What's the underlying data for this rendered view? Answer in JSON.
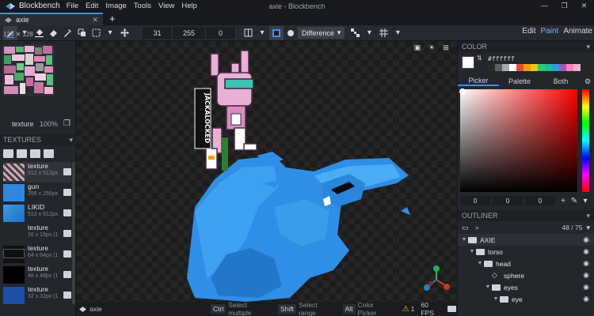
{
  "titlebar": {
    "app_name": "Blockbench",
    "window_title": "axie - Blockbench",
    "menu": [
      "File",
      "Edit",
      "Image",
      "Tools",
      "View",
      "Help"
    ],
    "controls": [
      "—",
      "❐",
      "✕"
    ]
  },
  "tabbar": {
    "tab_label": "axie",
    "close": "✕",
    "new_tab": "+"
  },
  "toolbar": {
    "field_1": "31",
    "field_2": "255",
    "field_3": "0",
    "blend_mode": "Difference",
    "modes": [
      "Edit",
      "Paint",
      "Animate"
    ],
    "active_mode": "Paint"
  },
  "left": {
    "uv_size": "128 ✕ 128",
    "texture_label": "texture",
    "zoom": "100%",
    "textures_header": "TEXTURES",
    "textures": [
      {
        "name": "texture",
        "size": "512 x 512px",
        "thumb": "#c9a5b6"
      },
      {
        "name": "gun",
        "size": "256 x 256px",
        "thumb": "#2e86de"
      },
      {
        "name": "LIKID",
        "size": "512 x 512px",
        "thumb": "#3a9be8"
      },
      {
        "name": "texture",
        "size": "16 x 16px (1",
        "thumb": "#24272c"
      },
      {
        "name": "texture",
        "size": "64 x 64px (1",
        "thumb": "#101010"
      },
      {
        "name": "texture",
        "size": "48 x 48px (1",
        "thumb": "#000000"
      },
      {
        "name": "texture",
        "size": "32 x 32px (1",
        "thumb": "#1d4fa8"
      }
    ]
  },
  "viewport": {
    "tools": [
      "▣",
      "☀",
      "⊞"
    ]
  },
  "status": {
    "model_name": "axie",
    "hints": [
      {
        "key": "Ctrl",
        "text": "Select multiple"
      },
      {
        "key": "Shift",
        "text": "Select range"
      },
      {
        "key": "Alt",
        "text": "Color Picker"
      }
    ],
    "warn_count": "1",
    "fps": "60 FPS"
  },
  "color": {
    "header": "COLOR",
    "hex": "#ffffff",
    "tabs": [
      "Picker",
      "Palette",
      "Both"
    ],
    "active_tab": "Picker",
    "palette": [
      "#2b2b2b",
      "#5e5e5e",
      "#a8a8a8",
      "#ffffff",
      "#e74c3c",
      "#f39c12",
      "#f1c40f",
      "#2ecc71",
      "#1abc9c",
      "#3498db",
      "#9b59b6",
      "#ff7eb6",
      "#e7b0d4"
    ],
    "r": "0",
    "g": "0",
    "b": "0"
  },
  "outliner": {
    "header": "OUTLINER",
    "count": "48 / 75",
    "rows": [
      {
        "label": "AXIE",
        "depth": 0,
        "type": "group",
        "open": true
      },
      {
        "label": "torso",
        "depth": 1,
        "type": "group",
        "open": true
      },
      {
        "label": "head",
        "depth": 2,
        "type": "group",
        "open": true
      },
      {
        "label": "sphere",
        "depth": 3,
        "type": "mesh",
        "open": false
      },
      {
        "label": "eyes",
        "depth": 3,
        "type": "group",
        "open": true
      },
      {
        "label": "eye",
        "depth": 4,
        "type": "group",
        "open": true
      }
    ]
  }
}
